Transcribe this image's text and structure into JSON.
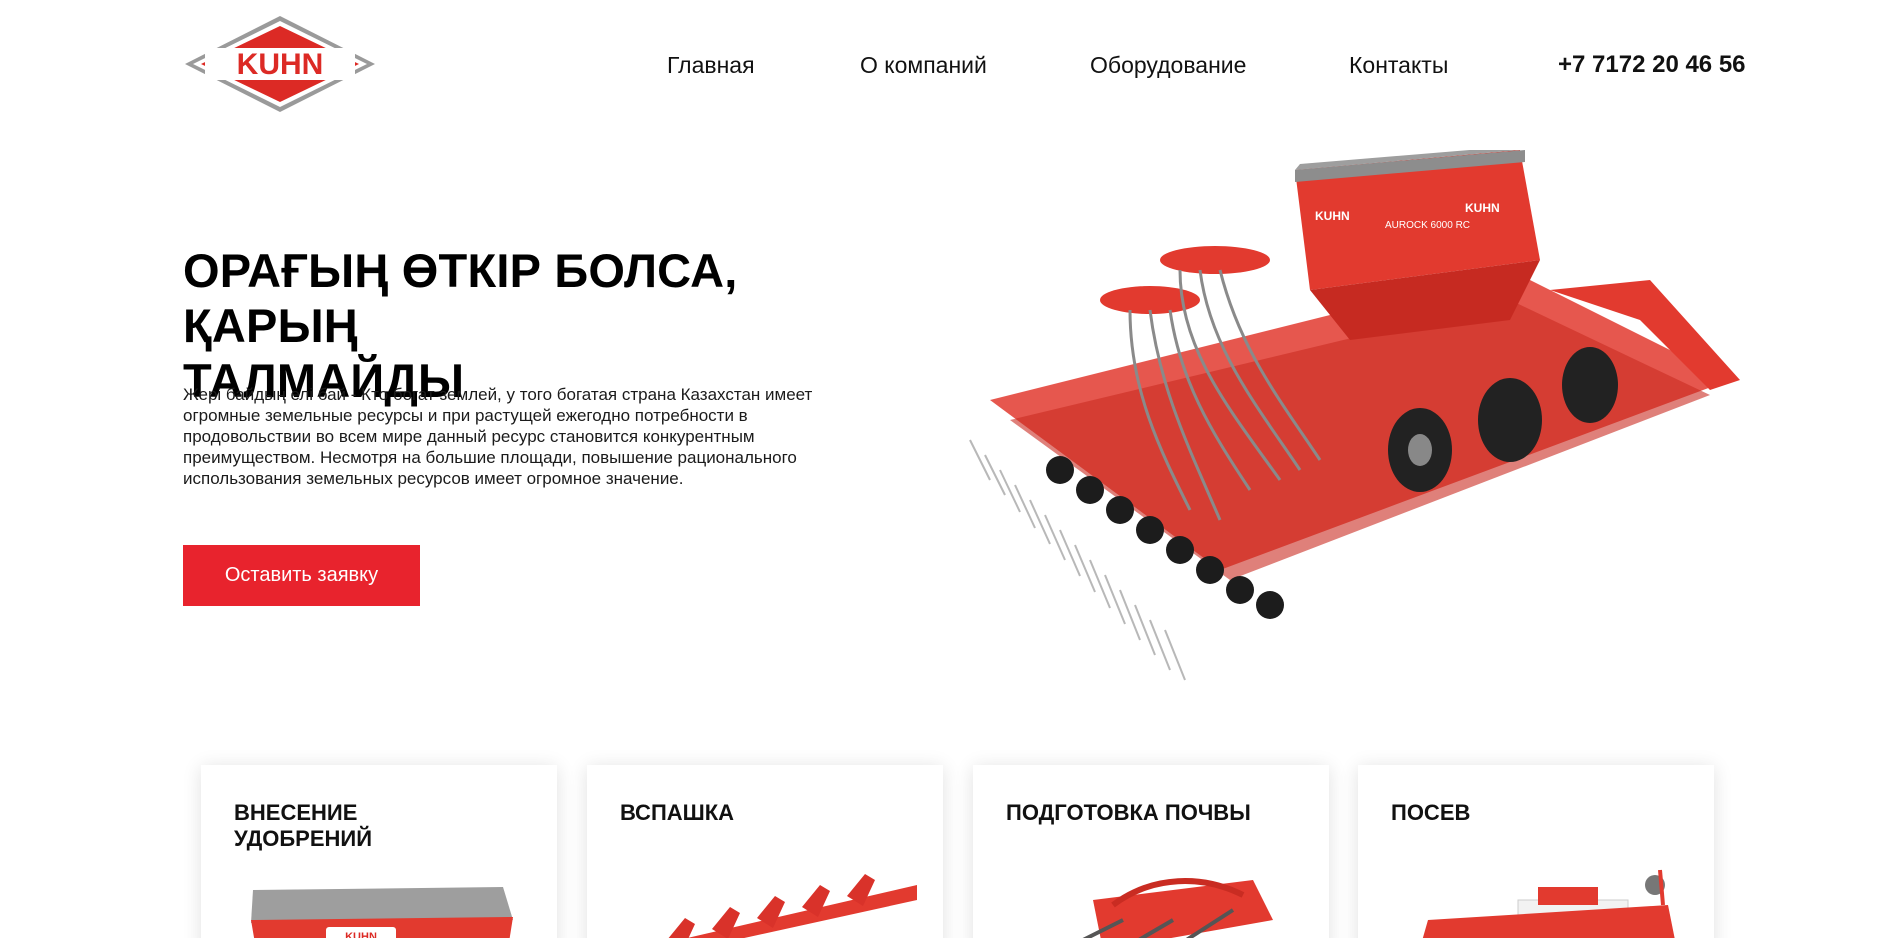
{
  "brand": {
    "logo_text": "KUHN"
  },
  "nav": {
    "items": [
      {
        "label": "Главная"
      },
      {
        "label": "О компаний"
      },
      {
        "label": "Оборудование"
      },
      {
        "label": "Контакты"
      }
    ],
    "phone": "+7 7172 20 46 56"
  },
  "hero": {
    "title_line1": "ОРАҒЫҢ ӨТКІР БОЛСА, ҚАРЫҢ",
    "title_line2": "ТАЛМАЙДЫ",
    "description": "Жері байдың елі бай - Кто богат землей, у того богатая страна Казахстан имеет огромные земельные ресурсы и при растущей ежегодно потребности в продовольствии во всем мире данный ресурс становится конкурентным преимуществом. Несмотря на большие площади, повышение рационального использования земельных ресурсов имеет огромное значение.",
    "cta_label": "Оставить заявку",
    "machine_labels": {
      "hopper_brand": "KUHN",
      "hopper_model": "AUROCK 6000 RC"
    }
  },
  "categories": [
    {
      "title": "ВНЕСЕНИЕ УДОБРЕНИЙ",
      "icon": "spreader-image"
    },
    {
      "title": "ВСПАШКА",
      "icon": "plough-image"
    },
    {
      "title": "ПОДГОТОВКА ПОЧВЫ",
      "icon": "cultivator-image"
    },
    {
      "title": "ПОСЕВ",
      "icon": "seeder-image"
    }
  ],
  "colors": {
    "accent": "#e8232d",
    "machine_red": "#e23a2f",
    "text": "#111111"
  }
}
